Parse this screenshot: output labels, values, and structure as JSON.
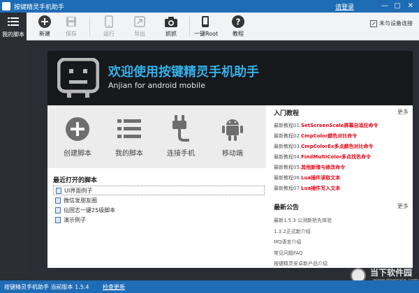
{
  "titlebar": {
    "title": "按键精灵手机助手",
    "login": "请登录",
    "min": "—",
    "max": "▢",
    "close": "✕"
  },
  "sidebar": {
    "label": "我的脚本"
  },
  "toolbar": {
    "items": [
      {
        "label": "新建",
        "icon": "plus-icon",
        "enabled": true
      },
      {
        "label": "保存",
        "icon": "save-icon",
        "enabled": false
      },
      {
        "label": "运行",
        "icon": "run-icon",
        "enabled": false
      },
      {
        "label": "导出",
        "icon": "export-icon",
        "enabled": false
      },
      {
        "label": "抓抓",
        "icon": "camera-icon",
        "enabled": true
      },
      {
        "label": "一键Root",
        "icon": "root-icon",
        "enabled": true
      },
      {
        "label": "教程",
        "icon": "help-icon",
        "enabled": true
      }
    ],
    "connection": "未与设备连接"
  },
  "banner": {
    "title": "欢迎使用按键精灵手机助手",
    "subtitle": "Anjian for android mobile"
  },
  "quick_actions": [
    {
      "label": "创建脚本",
      "icon": "plus-circle-icon"
    },
    {
      "label": "我的脚本",
      "icon": "list-icon"
    },
    {
      "label": "连接手机",
      "icon": "usb-cable-icon"
    },
    {
      "label": "移动端",
      "icon": "android-icon"
    }
  ],
  "recent": {
    "title": "最近打开的脚本",
    "items": [
      "UI界面例子",
      "微信发朋友圈",
      "仙国志一键25级脚本",
      "演示例子"
    ]
  },
  "tutorials": {
    "title": "入门教程",
    "more": "更多",
    "items": [
      {
        "prefix": "最新教程01.",
        "text": "SetScreenScale屏幕自适应命令"
      },
      {
        "prefix": "最新教程02.",
        "text": "CmpColor颜色对比命令"
      },
      {
        "prefix": "最新教程03.",
        "text": "CmpColorEx多点颜色对比命令"
      },
      {
        "prefix": "最新教程04.",
        "text": "FindMultiColor多点找色命令"
      },
      {
        "prefix": "最新教程05.",
        "text": "其他新增与修改命令"
      },
      {
        "prefix": "最新教程06.",
        "text": "Lua插件读取文本"
      },
      {
        "prefix": "最新教程07.",
        "text": "Lua插件写入文本"
      }
    ]
  },
  "announcements": {
    "title": "最新公告",
    "more": "更多",
    "items": [
      "最新1.5.3 公测新抢先体验",
      "1.3.2正式新介绍",
      "MQ语言介绍",
      "常见问题FAQ",
      "按键精灵安卓新产品介绍"
    ]
  },
  "statusbar": {
    "text": "按键精灵手机助手 当前版本 1.5.4",
    "link": "检查更新"
  },
  "watermark": {
    "text": "当下软件园",
    "sub": "www.downxia.com"
  },
  "colors": {
    "titlebar": "#1f6cb6",
    "accent_blue": "#33b1ea",
    "highlight_red": "#e60012",
    "icon_gray": "#6e6e6e",
    "sidebar": "#2b2e33",
    "banner": "#16181b"
  }
}
